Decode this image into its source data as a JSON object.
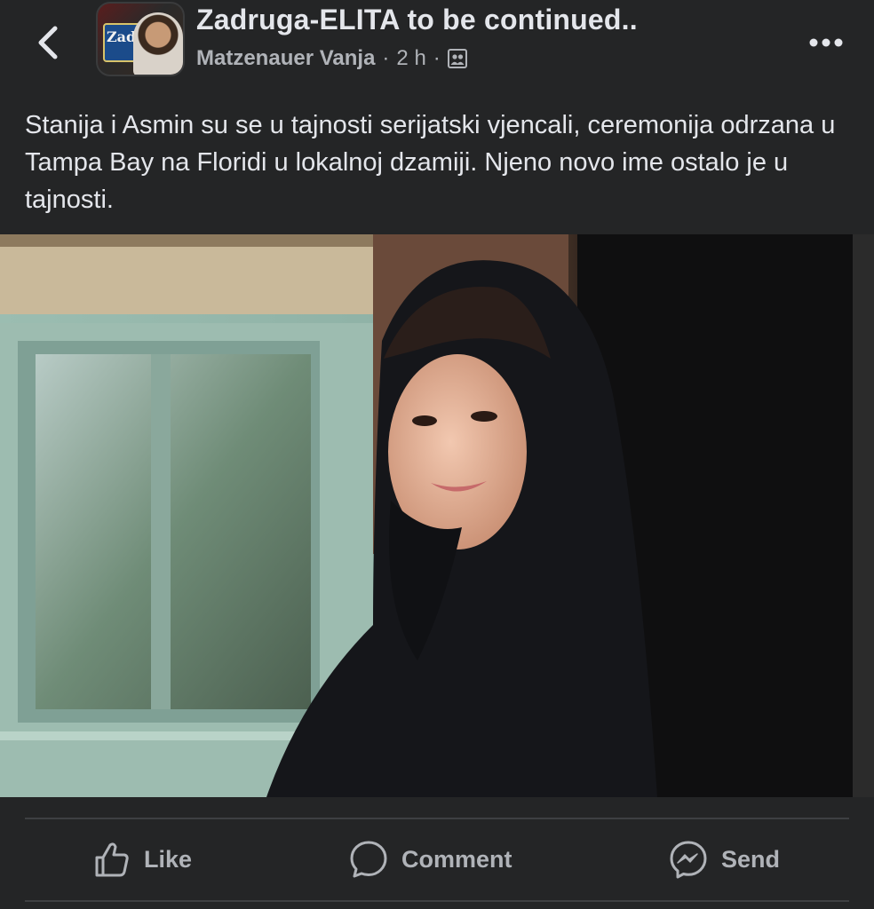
{
  "header": {
    "group_name": "Zadruga-ELITA to be continued..",
    "author": "Matzenauer Vanja",
    "separator": "·",
    "time": "2 h",
    "back_icon": "chevron-left-icon",
    "more_icon": "more-horizontal-icon",
    "audience_icon": "group-members-icon",
    "avatar_logo_text": "Zadr"
  },
  "post": {
    "text": "Stanija i Asmin su se u tajnosti serijatski vjencali, ceremonija odrzana u Tampa Bay na Floridi u lokalnoj dzamiji. Njeno novo ime ostalo je u tajnosti."
  },
  "actions": {
    "like_label": "Like",
    "comment_label": "Comment",
    "send_label": "Send"
  },
  "colors": {
    "background": "#242526",
    "text_primary": "#e4e6eb",
    "text_secondary": "#b0b3b8",
    "divider": "#3e4042"
  }
}
